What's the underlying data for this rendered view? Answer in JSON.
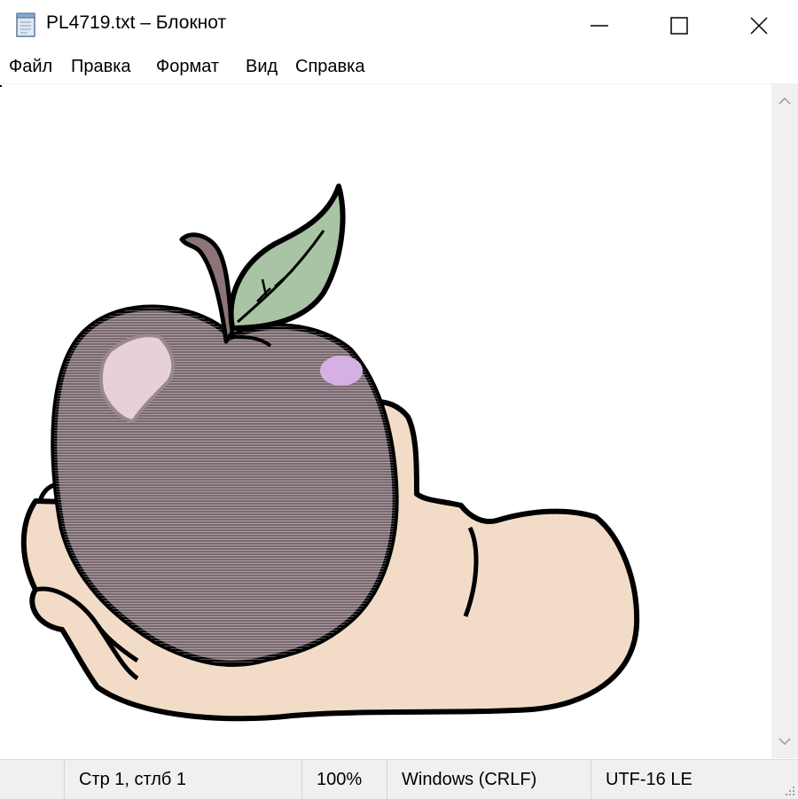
{
  "window": {
    "title": "PL4719.txt – Блокнот",
    "icon": "notepad-icon",
    "controls": [
      "minimize-icon",
      "maximize-icon",
      "close-icon"
    ]
  },
  "menu": {
    "items": [
      "Файл",
      "Правка",
      "Формат",
      "Вид",
      "Справка"
    ]
  },
  "editor": {
    "content": "ASCII-art picture: a hand holding an apple"
  },
  "status": {
    "position": "Стр 1, стлб 1",
    "zoom": "100%",
    "line_endings": "Windows (CRLF)",
    "encoding": "UTF-16 LE"
  },
  "colors": {
    "apple": "#7a6870",
    "apple_highlight": "#e8d0d8",
    "apple_spot": "#d4b0e4",
    "leaf": "#a8c4a4",
    "stem": "#8c7478",
    "hand": "#f2dcc8",
    "outline": "#000000",
    "chrome": "#f0f0f0"
  }
}
